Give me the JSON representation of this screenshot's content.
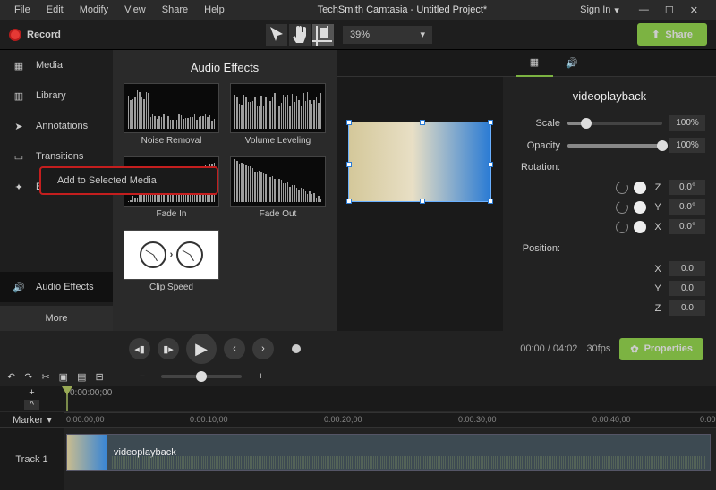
{
  "menubar": {
    "items": [
      "File",
      "Edit",
      "Modify",
      "View",
      "Share",
      "Help"
    ],
    "title": "TechSmith Camtasia - Untitled Project*",
    "signin": "Sign In"
  },
  "toolbar": {
    "record": "Record",
    "zoom": "39%",
    "share": "Share"
  },
  "sidebar": {
    "items": [
      {
        "label": "Media"
      },
      {
        "label": "Library"
      },
      {
        "label": "Annotations"
      },
      {
        "label": "Transitions"
      },
      {
        "label": "Behaviors"
      },
      {
        "label": "Audio Effects"
      }
    ],
    "more": "More"
  },
  "effects": {
    "title": "Audio Effects",
    "cards": [
      "Noise Removal",
      "Volume Leveling",
      "Fade In",
      "Fade Out",
      "Clip Speed"
    ],
    "context": "Add to Selected Media"
  },
  "props": {
    "title": "videoplayback",
    "scale": {
      "label": "Scale",
      "value": "100%"
    },
    "opacity": {
      "label": "Opacity",
      "value": "100%"
    },
    "rotation": {
      "label": "Rotation:",
      "axes": [
        "Z",
        "Y",
        "X"
      ],
      "value": "0.0°"
    },
    "position": {
      "label": "Position:",
      "axes": [
        "X",
        "Y",
        "Z"
      ],
      "value": "0.0"
    }
  },
  "player": {
    "time": "00:00 / 04:02",
    "fps": "30fps",
    "props_btn": "Properties"
  },
  "timeline": {
    "playhead_time": "0:00:00;00",
    "marker": "Marker",
    "ticks": [
      "0:00:00;00",
      "0:00:10;00",
      "0:00:20;00",
      "0:00:30;00",
      "0:00:40;00",
      "0:00"
    ],
    "track": "Track 1",
    "clip": "videoplayback"
  }
}
